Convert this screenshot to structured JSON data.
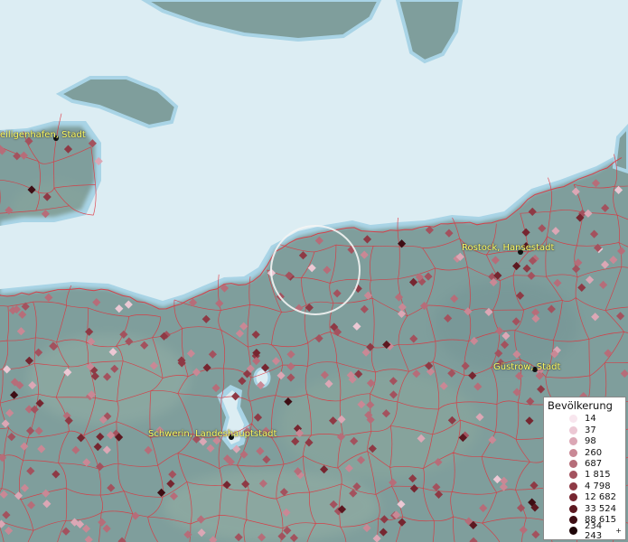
{
  "map": {
    "colors": {
      "sea": "#dcedf3",
      "sea_edge": "#a9d4e6",
      "land": "#7f9e9c",
      "border": "#e0303a",
      "label": "#ffff66",
      "highlight_ring": "#f4f4f4"
    },
    "cities": [
      {
        "name": "eiligenhafen, Stadt"
      },
      {
        "name": "Rostock, Hansestadt"
      },
      {
        "name": "Güstrow, Stadt"
      },
      {
        "name": "Schwerin, Landeshauptstadt"
      }
    ],
    "highlight": "selection-ring"
  },
  "legend": {
    "title": "Bevölkerung",
    "items": [
      {
        "label": "14",
        "color": "#f8e6ee"
      },
      {
        "label": "37",
        "color": "#ecc8d4"
      },
      {
        "label": "98",
        "color": "#dba7b5"
      },
      {
        "label": "260",
        "color": "#c98895"
      },
      {
        "label": "687",
        "color": "#b66d79"
      },
      {
        "label": "1 815",
        "color": "#a3525e"
      },
      {
        "label": "4 798",
        "color": "#8e3a45"
      },
      {
        "label": "12 682",
        "color": "#762630"
      },
      {
        "label": "33 524",
        "color": "#5c1820"
      },
      {
        "label": "88 615",
        "color": "#3e0e14"
      },
      {
        "label": "234 243",
        "color": "#1e0508"
      }
    ],
    "plus_mark": "+"
  }
}
